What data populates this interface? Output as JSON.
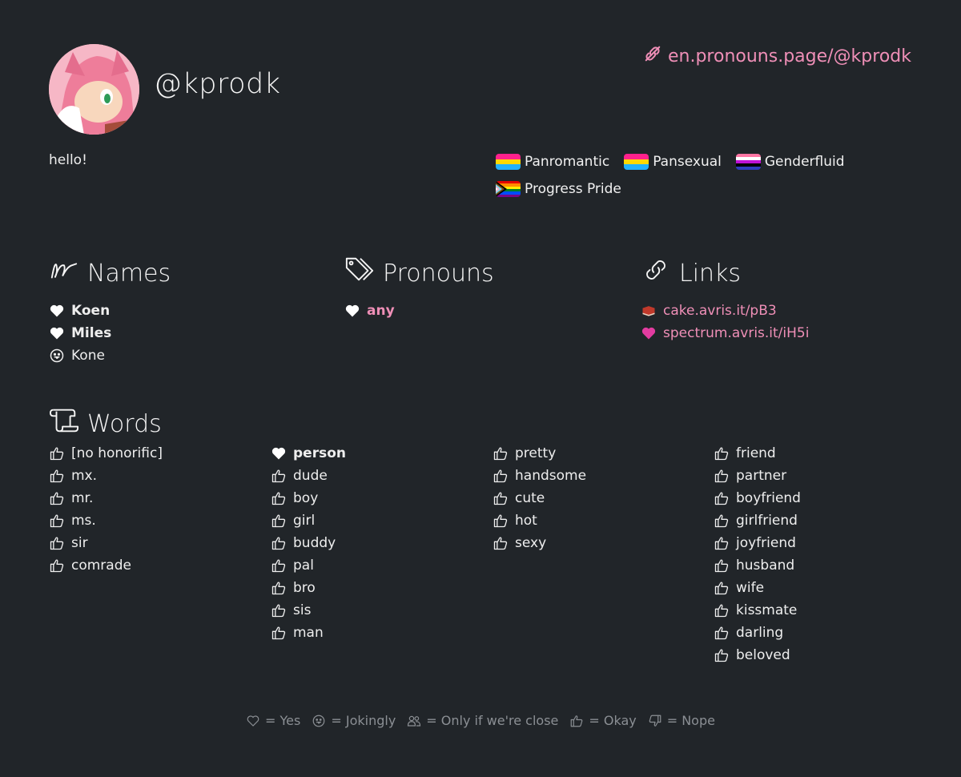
{
  "profile": {
    "username": "@kprodk",
    "link_text": "en.pronouns.page/@kprodk",
    "bio": "hello!"
  },
  "flags": [
    {
      "label": "Panromantic",
      "colors": [
        "#ff218c",
        "#ffd800",
        "#21b1ff"
      ]
    },
    {
      "label": "Pansexual",
      "colors": [
        "#ff218c",
        "#ffd800",
        "#21b1ff"
      ]
    },
    {
      "label": "Genderfluid",
      "colors": [
        "#ff76a4",
        "#ffffff",
        "#c011d7",
        "#000000",
        "#2f3cbe"
      ]
    },
    {
      "label": "Progress Pride",
      "colors": [
        "#e40303",
        "#ff8c00",
        "#ffed00",
        "#008026",
        "#004dff",
        "#750787"
      ]
    }
  ],
  "names": {
    "title": "Names",
    "items": [
      {
        "label": "Koen",
        "icon": "heart-icon"
      },
      {
        "label": "Miles",
        "icon": "heart-icon"
      },
      {
        "label": "Kone",
        "icon": "smiley-tongue-icon"
      }
    ]
  },
  "pronouns": {
    "title": "Pronouns",
    "items": [
      {
        "label": "any",
        "icon": "heart-icon"
      }
    ]
  },
  "links": {
    "title": "Links",
    "items": [
      {
        "label": "cake.avris.it/pB3",
        "icon": "book-icon"
      },
      {
        "label": "spectrum.avris.it/iH5i",
        "icon": "pink-heart-icon"
      }
    ]
  },
  "words": {
    "title": "Words",
    "columns": [
      [
        {
          "label": "[no honorific]"
        },
        {
          "label": "mx."
        },
        {
          "label": "mr."
        },
        {
          "label": "ms."
        },
        {
          "label": "sir"
        },
        {
          "label": "comrade"
        }
      ],
      [
        {
          "label": "person",
          "fav": true
        },
        {
          "label": "dude"
        },
        {
          "label": "boy"
        },
        {
          "label": "girl"
        },
        {
          "label": "buddy"
        },
        {
          "label": "pal"
        },
        {
          "label": "bro"
        },
        {
          "label": "sis"
        },
        {
          "label": "man"
        }
      ],
      [
        {
          "label": "pretty"
        },
        {
          "label": "handsome"
        },
        {
          "label": "cute"
        },
        {
          "label": "hot"
        },
        {
          "label": "sexy"
        }
      ],
      [
        {
          "label": "friend"
        },
        {
          "label": "partner"
        },
        {
          "label": "boyfriend"
        },
        {
          "label": "girlfriend"
        },
        {
          "label": "joyfriend"
        },
        {
          "label": "husband"
        },
        {
          "label": "wife"
        },
        {
          "label": "kissmate"
        },
        {
          "label": "darling"
        },
        {
          "label": "beloved"
        }
      ]
    ]
  },
  "legend": [
    {
      "label": "= Yes",
      "icon": "heart-outline-icon"
    },
    {
      "label": "= Jokingly",
      "icon": "smiley-tongue-icon"
    },
    {
      "label": "= Only if we're close",
      "icon": "users-icon"
    },
    {
      "label": "= Okay",
      "icon": "thumbs-up-icon"
    },
    {
      "label": "= Nope",
      "icon": "thumbs-down-icon"
    }
  ],
  "colors": {
    "background": "#212529",
    "accent": "#ef8fb7",
    "muted": "#8b8f94"
  }
}
